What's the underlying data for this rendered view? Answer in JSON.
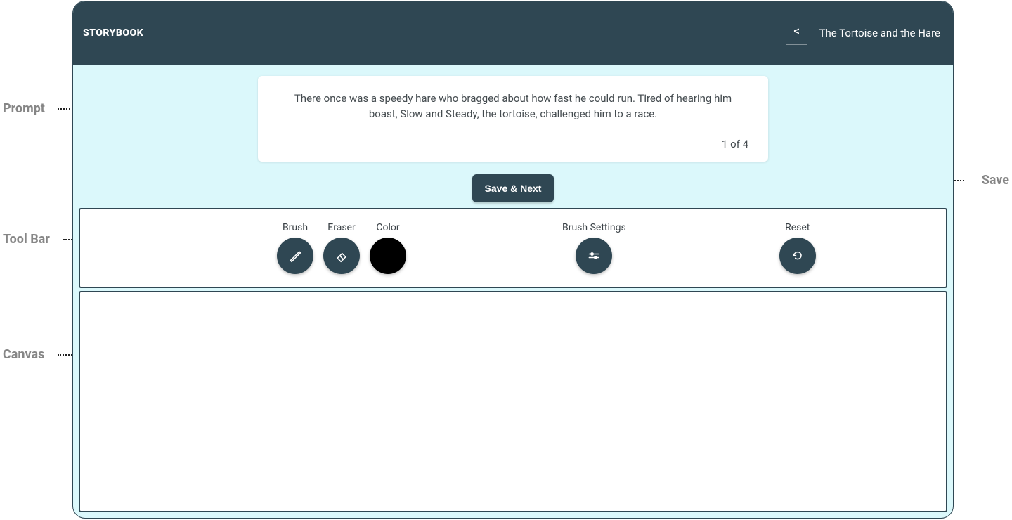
{
  "annotations": {
    "prompt": "Prompt",
    "save": "Save",
    "toolbar": "Tool Bar",
    "canvas": "Canvas"
  },
  "header": {
    "brand": "STORYBOOK",
    "back_glyph": "<",
    "story_title": "The Tortoise and the Hare"
  },
  "prompt": {
    "text": "There once was a speedy hare who bragged about how fast he could run. Tired of hearing him boast, Slow and Steady, the tortoise, challenged him to a race.",
    "pager": "1 of 4"
  },
  "actions": {
    "save_next": "Save & Next"
  },
  "toolbar": {
    "brush_label": "Brush",
    "eraser_label": "Eraser",
    "color_label": "Color",
    "settings_label": "Brush Settings",
    "reset_label": "Reset",
    "color_value": "#000000"
  }
}
